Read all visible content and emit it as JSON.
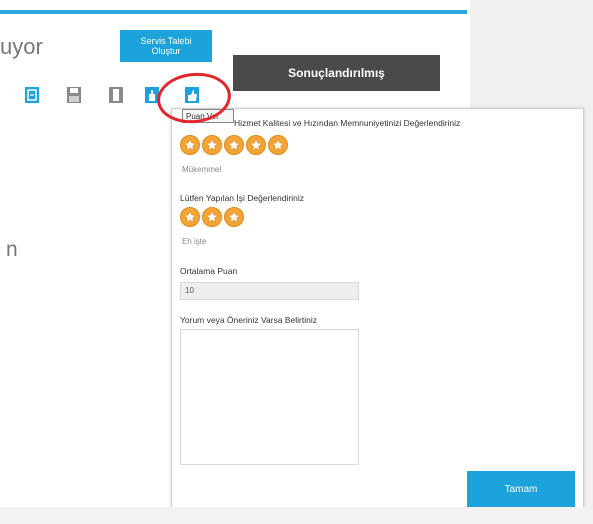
{
  "page": {
    "title_fragment": "uyor",
    "title_fragment_2": "n",
    "service_button": "Servis Talebi Oluştur",
    "status": "Sonuçlandırılmış",
    "tooltip": "Puan Ver"
  },
  "toolbar": {
    "icons": [
      "document-icon",
      "save-icon",
      "bookmark-icon",
      "hand-icon",
      "thumbs-up-icon"
    ]
  },
  "dialog": {
    "q1": {
      "label": "Hizmet Kalitesi ve Hızından Memnuniyetinizi Değerlendiriniz",
      "stars": 5,
      "value_label": "Mükemmel"
    },
    "q2": {
      "label": "Lütfen Yapılan İşi Değerlendiriniz",
      "stars": 3,
      "value_label": "Eh işte"
    },
    "average": {
      "label": "Ortalama Puan",
      "value": "10"
    },
    "comment": {
      "label": "Yorum veya Öneriniz Varsa Belirtiniz",
      "value": ""
    },
    "ok_button": "Tamam"
  },
  "colors": {
    "accent": "#1ca3dc",
    "banner": "#4a4a4a",
    "star": "#f3a538",
    "highlight": "#e2262b"
  }
}
